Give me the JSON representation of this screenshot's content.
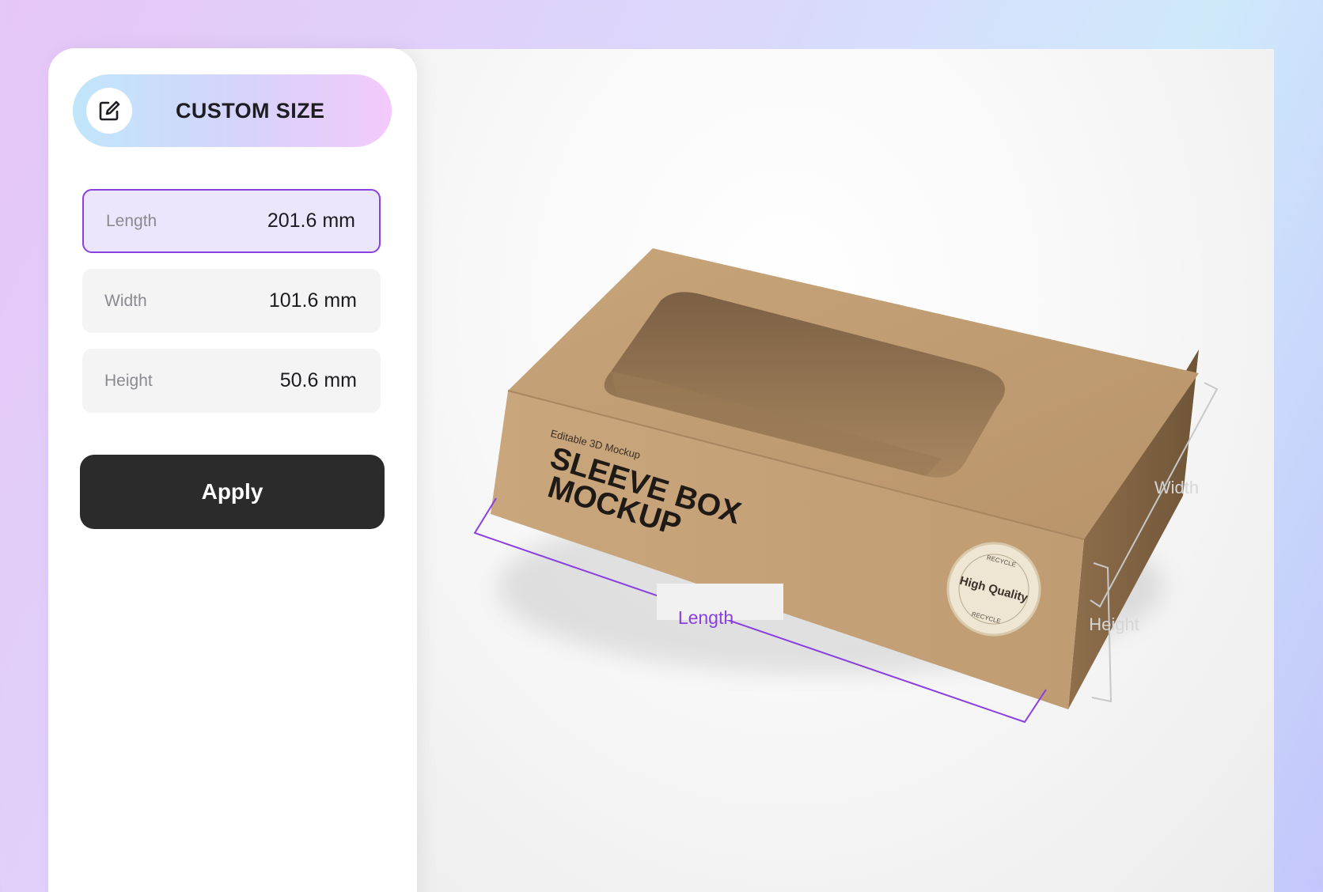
{
  "panel": {
    "header": {
      "label": "CUSTOM SIZE",
      "icon": "edit-icon"
    },
    "fields": [
      {
        "label": "Length",
        "value": "201.6 mm",
        "active": true
      },
      {
        "label": "Width",
        "value": "101.6 mm",
        "active": false
      },
      {
        "label": "Height",
        "value": "50.6 mm",
        "active": false
      }
    ],
    "apply_label": "Apply"
  },
  "preview": {
    "box_small_text": "Editable 3D Mockup",
    "box_title_line1": "SLEEVE BOX",
    "box_title_line2": "MOCKUP",
    "seal_text": "High Quality",
    "seal_ring_text": "RECYCLE",
    "dimension_labels": {
      "length": "Length",
      "width": "Width",
      "height": "Height"
    }
  },
  "colors": {
    "accent": "#8a3fe0",
    "apply_button": "#2b2b2b",
    "kraft": "#c9a57a"
  }
}
